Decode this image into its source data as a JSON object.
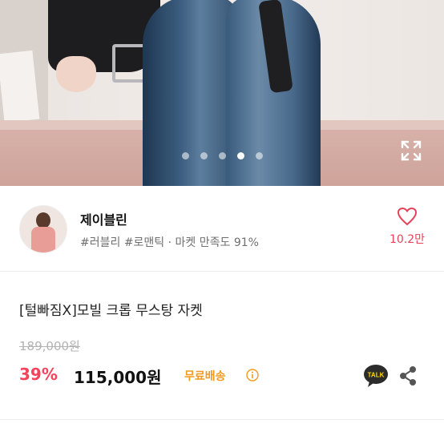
{
  "gallery": {
    "slides": [
      false,
      false,
      false,
      true,
      false
    ],
    "expand_icon": "expand-icon"
  },
  "shop": {
    "name": "제이블린",
    "tags": "#러블리 #로맨틱 · 마켓 만족도 91%",
    "favorite_count": "10.2만",
    "accent": "#e8415a"
  },
  "product": {
    "title": "[털빠짐X]모빌 크롭 무스탕 자켓",
    "original_price": "189,000원",
    "discount": "39%",
    "price": "115,000원",
    "shipping": "무료배송",
    "talk_label": "TALK"
  },
  "colors": {
    "discount": "#f2455b",
    "shipping": "#f29a1f"
  }
}
